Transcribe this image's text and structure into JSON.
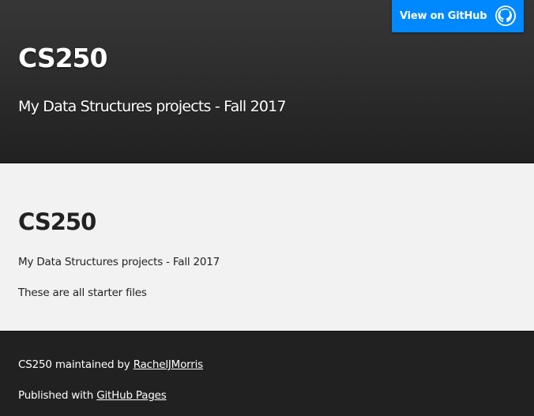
{
  "header": {
    "title": "CS250",
    "tagline": "My Data Structures projects - Fall 2017",
    "github_button": {
      "label": "View on GitHub",
      "icon": "github-octocat-icon",
      "background": "#0088ff"
    }
  },
  "main": {
    "heading": "CS250",
    "paragraphs": [
      "My Data Structures projects - Fall 2017",
      "These are all starter files"
    ]
  },
  "footer": {
    "maintained_prefix": "CS250 maintained by ",
    "maintainer_link": "RachelJMorris",
    "published_prefix": "Published with ",
    "pages_link": "GitHub Pages"
  },
  "colors": {
    "header_top": "#373737",
    "header_bottom": "#212121",
    "body_bg": "#f2f2f2",
    "footer_bg": "#212121",
    "text_dark": "#222222",
    "text_light": "#ffffff"
  }
}
